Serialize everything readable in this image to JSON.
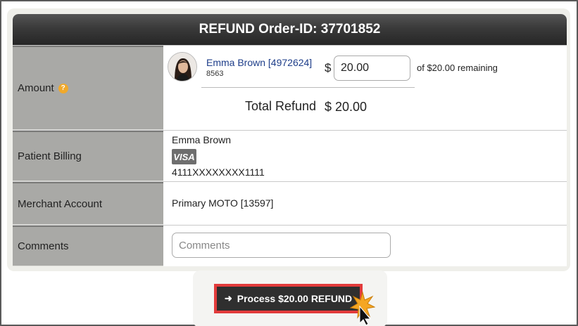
{
  "header": {
    "title": "REFUND Order-ID: 37701852"
  },
  "rows": {
    "amount": {
      "label": "Amount",
      "help_icon": "question-circle-icon",
      "patient_name": "Emma Brown [4972624]",
      "patient_sub": "8563",
      "currency": "$",
      "amount_value": "20.00",
      "remaining": "of  $20.00 remaining",
      "total_label": "Total Refund",
      "total_value": "$ 20.00"
    },
    "billing": {
      "label": "Patient Billing",
      "name": "Emma Brown",
      "card_brand": "VISA",
      "card_number": "4111XXXXXXXX1111"
    },
    "merchant": {
      "label": "Merchant Account",
      "value": "Primary MOTO [13597]"
    },
    "comments": {
      "label": "Comments",
      "placeholder": "Comments"
    }
  },
  "action": {
    "label": "Process $20.00 REFUND",
    "icon": "sign-in-icon"
  },
  "colors": {
    "header_bg": "#2f2f2f",
    "label_bg": "#a9a9a6",
    "highlight": "#e23b3b",
    "link": "#1e3e8a"
  }
}
